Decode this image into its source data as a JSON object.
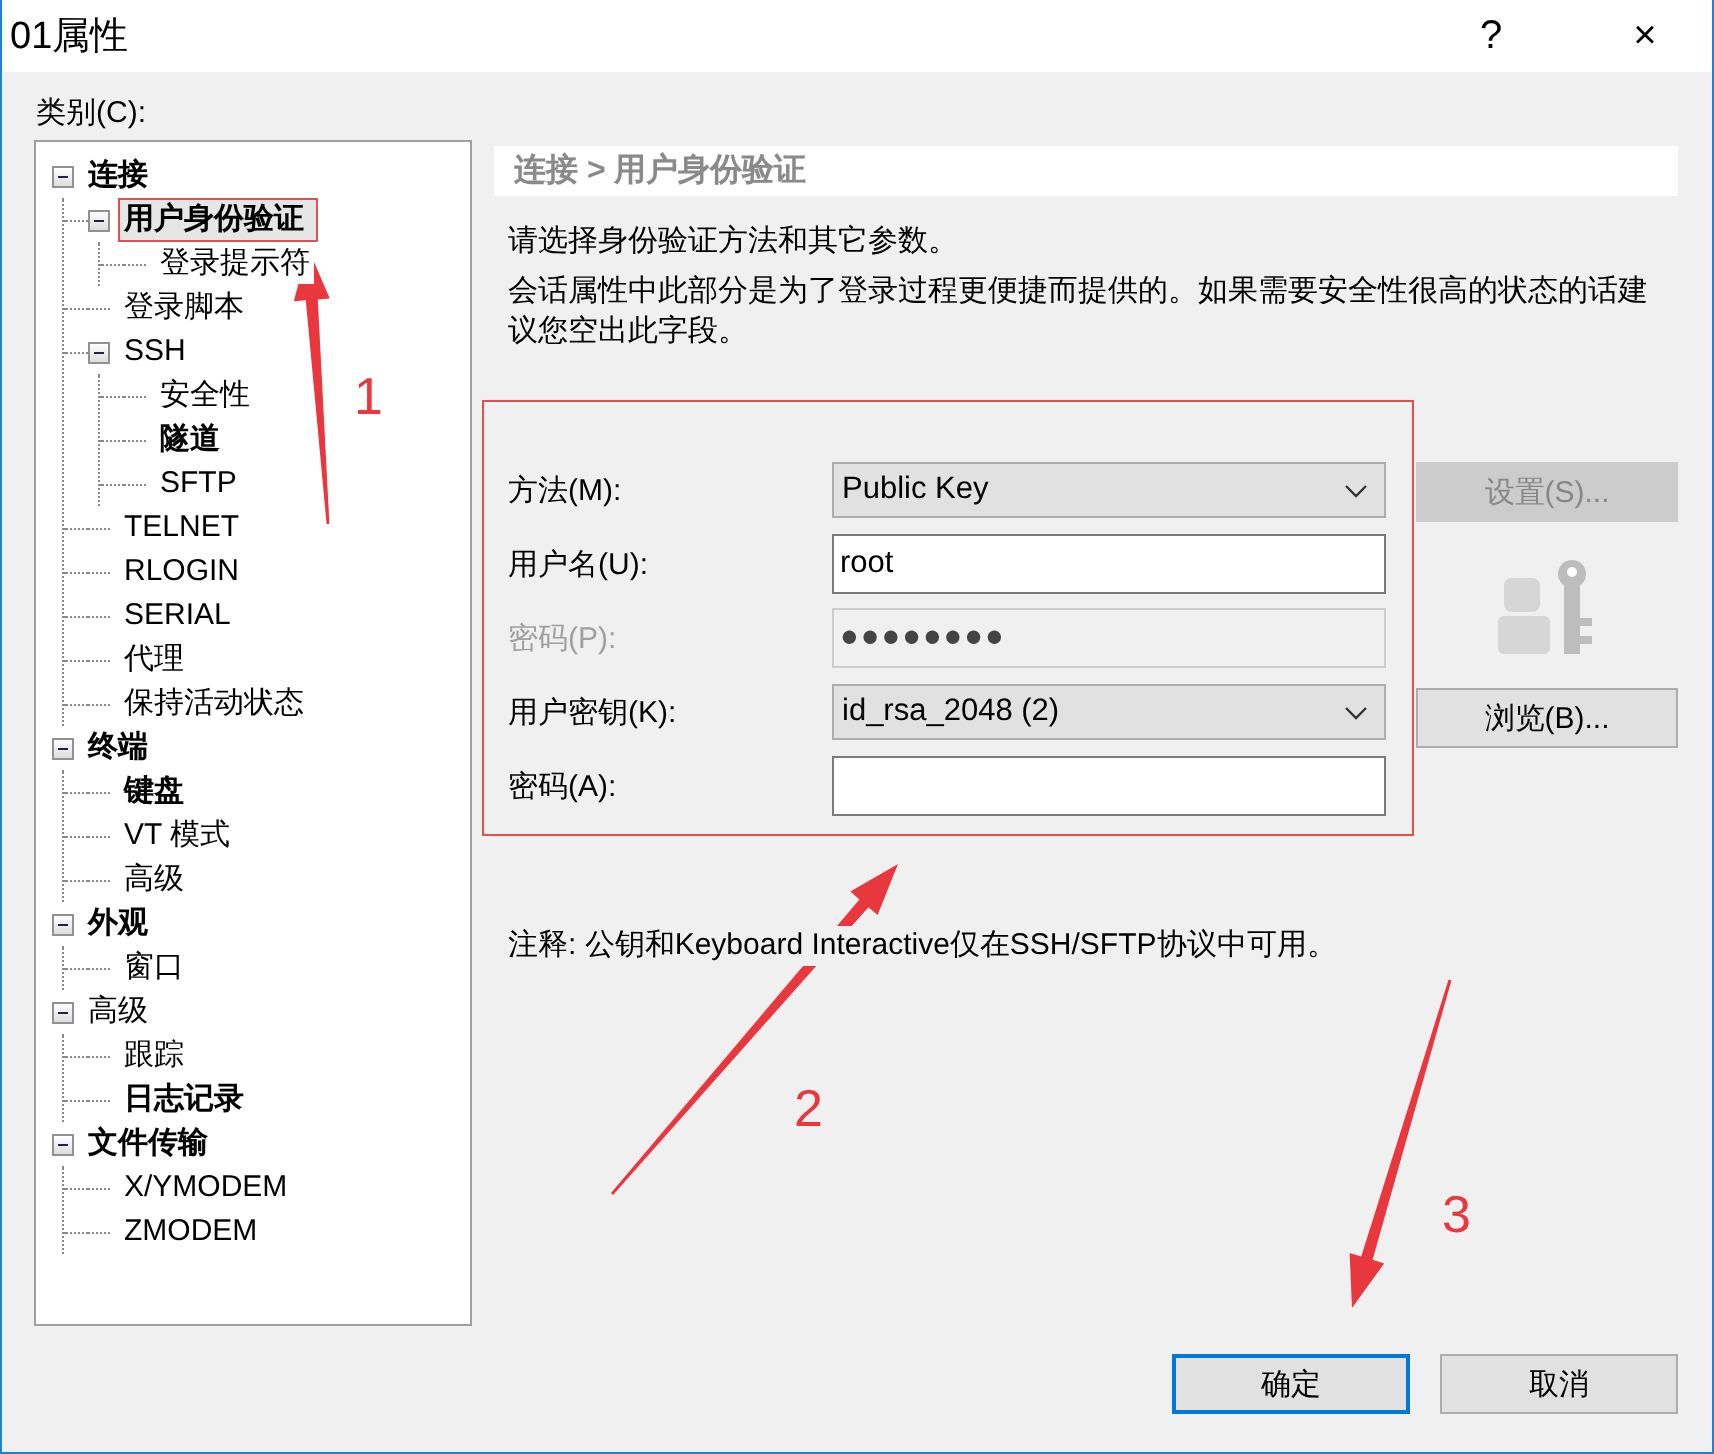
{
  "window": {
    "title": "01属性",
    "help": "?",
    "close": "×"
  },
  "category_label": "类别(C):",
  "tree": [
    {
      "label": "连接",
      "bold": true,
      "selected": false,
      "annotated": false,
      "expanded": true,
      "children": [
        {
          "label": "用户身份验证",
          "bold": true,
          "selected": true,
          "annotated": true,
          "expanded": true,
          "children": [
            {
              "label": "登录提示符",
              "bold": false,
              "selected": false,
              "annotated": false
            }
          ]
        },
        {
          "label": "登录脚本",
          "bold": false,
          "selected": false,
          "annotated": false
        },
        {
          "label": "SSH",
          "bold": false,
          "selected": false,
          "annotated": false,
          "expanded": true,
          "children": [
            {
              "label": "安全性",
              "bold": false,
              "selected": false,
              "annotated": false
            },
            {
              "label": "隧道",
              "bold": true,
              "selected": false,
              "annotated": false
            },
            {
              "label": "SFTP",
              "bold": false,
              "selected": false,
              "annotated": false
            }
          ]
        },
        {
          "label": "TELNET",
          "bold": false,
          "selected": false,
          "annotated": false
        },
        {
          "label": "RLOGIN",
          "bold": false,
          "selected": false,
          "annotated": false
        },
        {
          "label": "SERIAL",
          "bold": false,
          "selected": false,
          "annotated": false
        },
        {
          "label": "代理",
          "bold": false,
          "selected": false,
          "annotated": false
        },
        {
          "label": "保持活动状态",
          "bold": false,
          "selected": false,
          "annotated": false
        }
      ]
    },
    {
      "label": "终端",
      "bold": true,
      "selected": false,
      "annotated": false,
      "expanded": true,
      "children": [
        {
          "label": "键盘",
          "bold": true,
          "selected": false,
          "annotated": false
        },
        {
          "label": "VT 模式",
          "bold": false,
          "selected": false,
          "annotated": false
        },
        {
          "label": "高级",
          "bold": false,
          "selected": false,
          "annotated": false
        }
      ]
    },
    {
      "label": "外观",
      "bold": true,
      "selected": false,
      "annotated": false,
      "expanded": true,
      "children": [
        {
          "label": "窗口",
          "bold": false,
          "selected": false,
          "annotated": false
        }
      ]
    },
    {
      "label": "高级",
      "bold": false,
      "selected": false,
      "annotated": false,
      "expanded": true,
      "children": [
        {
          "label": "跟踪",
          "bold": false,
          "selected": false,
          "annotated": false
        },
        {
          "label": "日志记录",
          "bold": true,
          "selected": false,
          "annotated": false
        }
      ]
    },
    {
      "label": "文件传输",
      "bold": true,
      "selected": false,
      "annotated": false,
      "expanded": true,
      "children": [
        {
          "label": "X/YMODEM",
          "bold": false,
          "selected": false,
          "annotated": false
        },
        {
          "label": "ZMODEM",
          "bold": false,
          "selected": false,
          "annotated": false
        }
      ]
    }
  ],
  "panel": {
    "breadcrumb": "连接 > 用户身份验证",
    "intro": "请选择身份验证方法和其它参数。",
    "description": "会话属性中此部分是为了登录过程更便捷而提供的。如果需要安全性很高的状态的话建议您空出此字段。",
    "form": {
      "annotated": true,
      "fields": [
        {
          "kind": "dropdown",
          "label": "方法(M):",
          "value": "Public Key",
          "disabled": false
        },
        {
          "kind": "text",
          "label": "用户名(U):",
          "value": "root",
          "disabled": false
        },
        {
          "kind": "text",
          "label": "密码(P):",
          "value": "●●●●●●●●",
          "disabled": true
        },
        {
          "kind": "dropdown",
          "label": "用户密钥(K):",
          "value": "id_rsa_2048 (2)",
          "disabled": false
        },
        {
          "kind": "password",
          "label": "密码(A):",
          "disabled": false
        }
      ]
    },
    "side_buttons": [
      {
        "label": "设置(S)...",
        "disabled": true
      },
      {
        "label": "浏览(B)...",
        "disabled": false
      }
    ],
    "note": "注释: 公钥和Keyboard Interactive仅在SSH/SFTP协议中可用。"
  },
  "buttons": [
    {
      "label": "确定",
      "focused": true
    },
    {
      "label": "取消",
      "focused": false
    }
  ],
  "annotations": [
    {
      "kind": "arrow",
      "label": "1"
    },
    {
      "kind": "arrow",
      "label": "2"
    },
    {
      "kind": "arrow",
      "label": "3"
    }
  ]
}
